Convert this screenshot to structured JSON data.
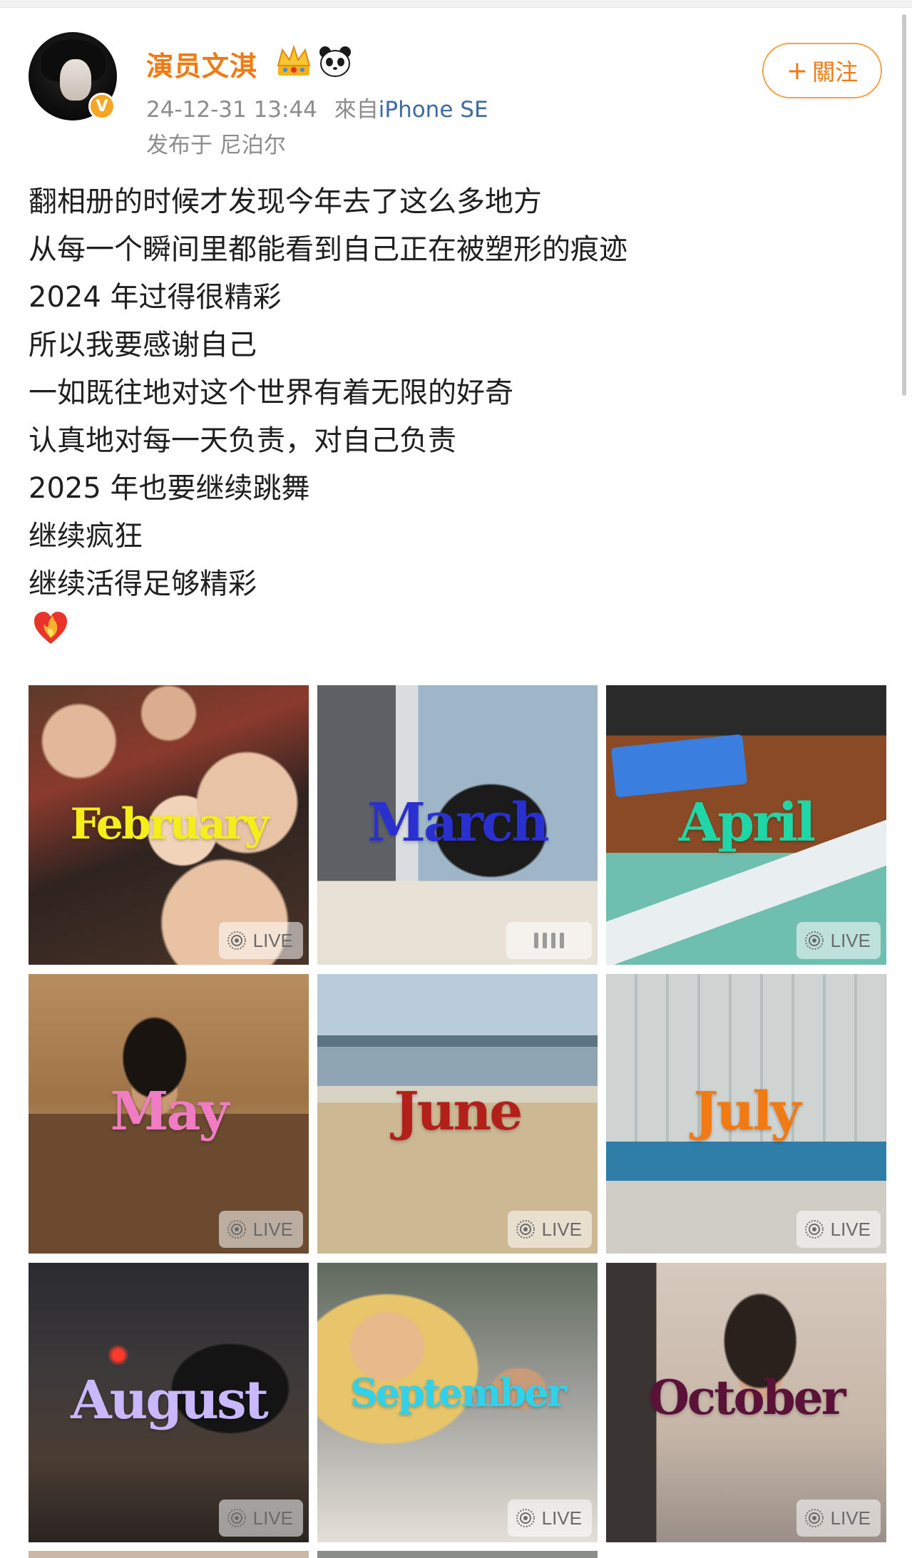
{
  "post": {
    "username": "演员文淇",
    "timestamp": "24-12-31 13:44",
    "source_prefix": "來自",
    "device": "iPhone SE",
    "location": "发布于 尼泊尔",
    "follow_label": "關注",
    "follow_plus": "+",
    "verified_mark": "V",
    "lines": [
      "翻相册的时候才发现今年去了这么多地方",
      "从每一个瞬间里都能看到自己正在被塑形的痕迹",
      "2024 年过得很精彩",
      "所以我要感谢自己",
      "一如既往地对这个世界有着无限的好奇",
      "认真地对每一天负责，对自己负责",
      "2025 年也要继续跳舞",
      "继续疯狂",
      "继续活得足够精彩"
    ]
  },
  "icons": {
    "crown": "crown-icon",
    "panda": "panda-icon",
    "heart": "heart-on-fire-icon",
    "live": "live-photo-icon"
  },
  "photos": [
    {
      "month": "February",
      "badge": "LIVE",
      "color": "#f5ee1a"
    },
    {
      "month": "March",
      "badge": "",
      "color": "#2a2fd0"
    },
    {
      "month": "April",
      "badge": "LIVE",
      "color": "#1fd6a6"
    },
    {
      "month": "May",
      "badge": "LIVE",
      "color": "#f07cc4"
    },
    {
      "month": "June",
      "badge": "LIVE",
      "color": "#b3201a"
    },
    {
      "month": "July",
      "badge": "LIVE",
      "color": "#f27a12"
    },
    {
      "month": "August",
      "badge": "LIVE",
      "color": "#c9b8ff"
    },
    {
      "month": "September",
      "badge": "LIVE",
      "color": "#2fd2ea"
    },
    {
      "month": "October",
      "badge": "LIVE",
      "color": "#5a1238"
    }
  ],
  "colors": {
    "username": "#f07a12",
    "device_link": "#3d6aa1",
    "meta_gray": "#8c8c8c",
    "follow_border": "#f3a14a",
    "verified_badge": "#f5a623"
  }
}
